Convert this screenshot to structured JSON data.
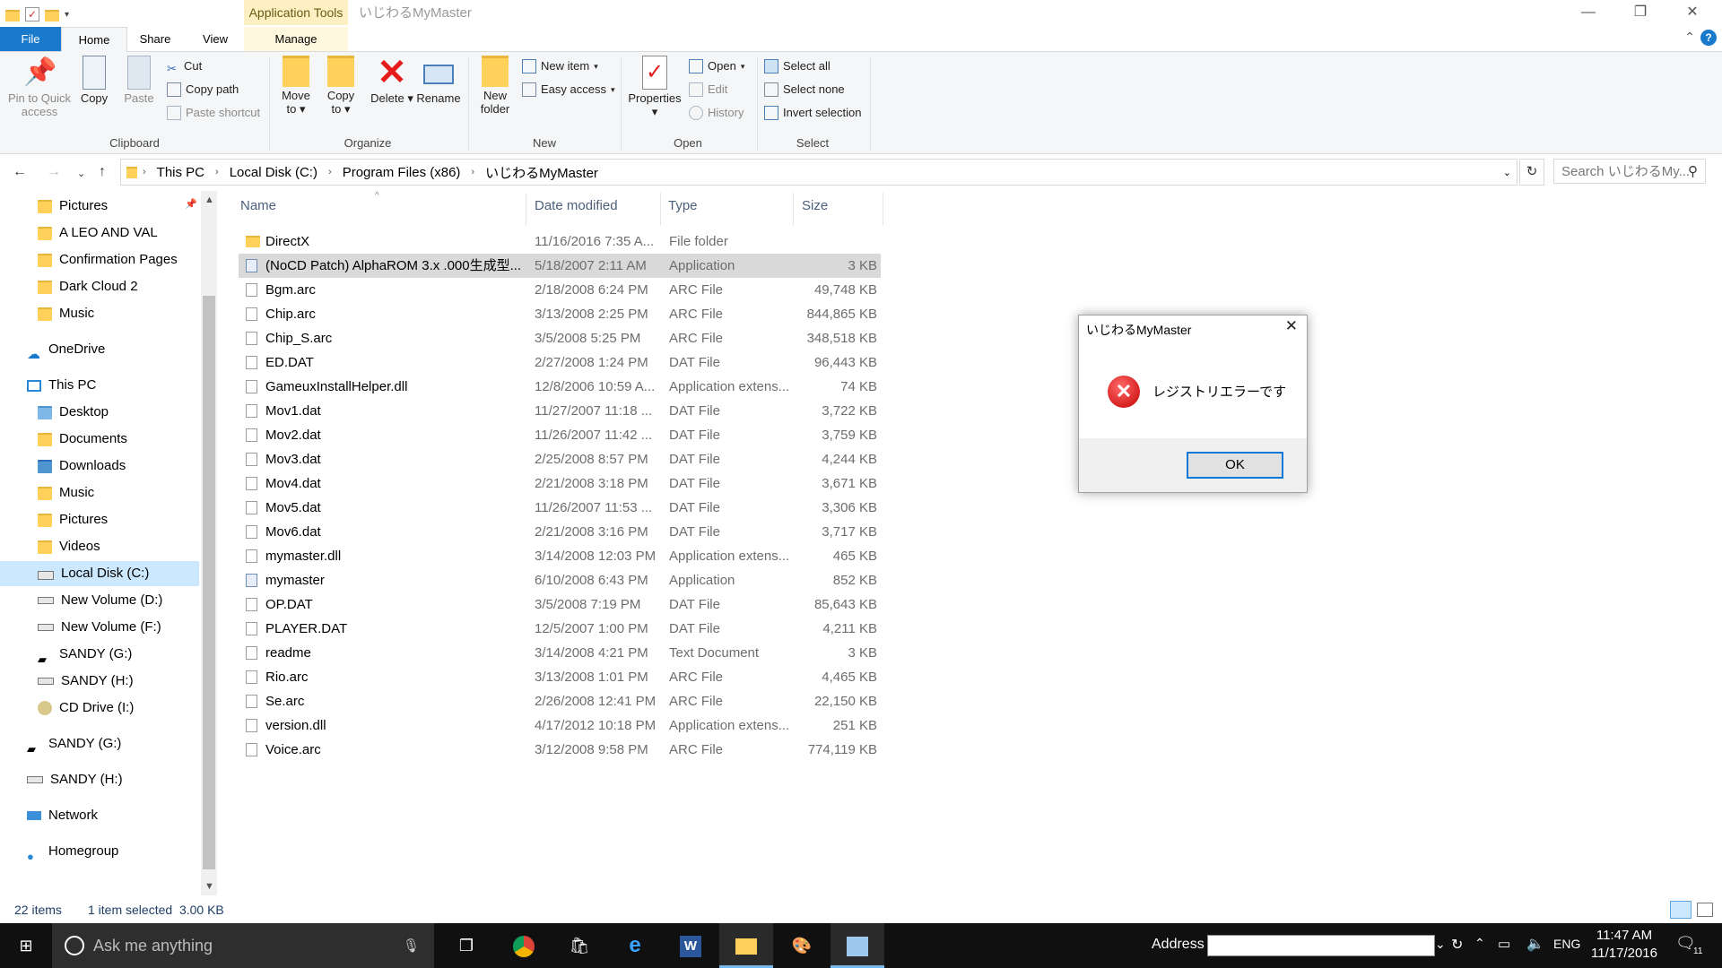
{
  "window": {
    "title": "いじわるMyMaster",
    "context_tab": "Application Tools",
    "controls": {
      "minimize": "—",
      "maximize": "❐",
      "close": "✕"
    }
  },
  "ribbon_tabs": {
    "file": "File",
    "home": "Home",
    "share": "Share",
    "view": "View",
    "manage": "Manage"
  },
  "ribbon": {
    "clipboard": {
      "label": "Clipboard",
      "pin": "Pin to Quick access",
      "copy": "Copy",
      "paste": "Paste",
      "cut": "Cut",
      "copy_path": "Copy path",
      "paste_shortcut": "Paste shortcut"
    },
    "organize": {
      "label": "Organize",
      "move_to": "Move to",
      "copy_to": "Copy to",
      "delete": "Delete",
      "rename": "Rename"
    },
    "new": {
      "label": "New",
      "new_folder": "New folder",
      "new_item": "New item",
      "easy_access": "Easy access"
    },
    "open": {
      "label": "Open",
      "properties": "Properties",
      "open": "Open",
      "edit": "Edit",
      "history": "History"
    },
    "select": {
      "label": "Select",
      "select_all": "Select all",
      "select_none": "Select none",
      "invert": "Invert selection"
    }
  },
  "address": {
    "crumbs": [
      "This PC",
      "Local Disk (C:)",
      "Program Files (x86)",
      "いじわるMyMaster"
    ],
    "search_placeholder": "Search いじわるMy..."
  },
  "nav": [
    {
      "label": "Pictures",
      "icon": "folder-icon"
    },
    {
      "label": "A LEO AND VAL",
      "icon": "folder-icon"
    },
    {
      "label": "Confirmation Pages",
      "icon": "folder-icon"
    },
    {
      "label": "Dark Cloud 2",
      "icon": "folder-icon"
    },
    {
      "label": "Music",
      "icon": "folder-icon"
    },
    {
      "label": "OneDrive",
      "icon": "cloud-icon"
    },
    {
      "label": "This PC",
      "icon": "computer-icon"
    },
    {
      "label": "Desktop",
      "icon": "folder-icon"
    },
    {
      "label": "Documents",
      "icon": "folder-icon"
    },
    {
      "label": "Downloads",
      "icon": "folder-icon"
    },
    {
      "label": "Music",
      "icon": "folder-icon"
    },
    {
      "label": "Pictures",
      "icon": "folder-icon"
    },
    {
      "label": "Videos",
      "icon": "folder-icon"
    },
    {
      "label": "Local Disk (C:)",
      "icon": "drive-icon"
    },
    {
      "label": "New Volume (D:)",
      "icon": "drive-icon"
    },
    {
      "label": "New Volume (F:)",
      "icon": "drive-icon"
    },
    {
      "label": "SANDY (G:)",
      "icon": "usb-drive-icon"
    },
    {
      "label": "SANDY (H:)",
      "icon": "drive-icon"
    },
    {
      "label": "CD Drive (I:)",
      "icon": "cd-drive-icon"
    },
    {
      "label": "SANDY (G:)",
      "icon": "usb-drive-icon"
    },
    {
      "label": "SANDY (H:)",
      "icon": "drive-icon"
    },
    {
      "label": "Network",
      "icon": "network-icon"
    },
    {
      "label": "Homegroup",
      "icon": "homegroup-icon"
    }
  ],
  "columns": {
    "name": "Name",
    "date": "Date modified",
    "type": "Type",
    "size": "Size"
  },
  "files": [
    {
      "name": "DirectX",
      "date": "11/16/2016 7:35 A...",
      "type": "File folder",
      "size": "",
      "kind": "folder"
    },
    {
      "name": "(NoCD Patch) AlphaROM 3.x .000生成型...",
      "date": "5/18/2007 2:11 AM",
      "type": "Application",
      "size": "3 KB",
      "kind": "app"
    },
    {
      "name": "Bgm.arc",
      "date": "2/18/2008 6:24 PM",
      "type": "ARC File",
      "size": "49,748 KB",
      "kind": "file"
    },
    {
      "name": "Chip.arc",
      "date": "3/13/2008 2:25 PM",
      "type": "ARC File",
      "size": "844,865 KB",
      "kind": "file"
    },
    {
      "name": "Chip_S.arc",
      "date": "3/5/2008 5:25 PM",
      "type": "ARC File",
      "size": "348,518 KB",
      "kind": "file"
    },
    {
      "name": "ED.DAT",
      "date": "2/27/2008 1:24 PM",
      "type": "DAT File",
      "size": "96,443 KB",
      "kind": "file"
    },
    {
      "name": "GameuxInstallHelper.dll",
      "date": "12/8/2006 10:59 A...",
      "type": "Application extens...",
      "size": "74 KB",
      "kind": "dll"
    },
    {
      "name": "Mov1.dat",
      "date": "11/27/2007 11:18 ...",
      "type": "DAT File",
      "size": "3,722 KB",
      "kind": "file"
    },
    {
      "name": "Mov2.dat",
      "date": "11/26/2007 11:42 ...",
      "type": "DAT File",
      "size": "3,759 KB",
      "kind": "file"
    },
    {
      "name": "Mov3.dat",
      "date": "2/25/2008 8:57 PM",
      "type": "DAT File",
      "size": "4,244 KB",
      "kind": "file"
    },
    {
      "name": "Mov4.dat",
      "date": "2/21/2008 3:18 PM",
      "type": "DAT File",
      "size": "3,671 KB",
      "kind": "file"
    },
    {
      "name": "Mov5.dat",
      "date": "11/26/2007 11:53 ...",
      "type": "DAT File",
      "size": "3,306 KB",
      "kind": "file"
    },
    {
      "name": "Mov6.dat",
      "date": "2/21/2008 3:16 PM",
      "type": "DAT File",
      "size": "3,717 KB",
      "kind": "file"
    },
    {
      "name": "mymaster.dll",
      "date": "3/14/2008 12:03 PM",
      "type": "Application extens...",
      "size": "465 KB",
      "kind": "dll"
    },
    {
      "name": "mymaster",
      "date": "6/10/2008 6:43 PM",
      "type": "Application",
      "size": "852 KB",
      "kind": "app"
    },
    {
      "name": "OP.DAT",
      "date": "3/5/2008 7:19 PM",
      "type": "DAT File",
      "size": "85,643 KB",
      "kind": "file"
    },
    {
      "name": "PLAYER.DAT",
      "date": "12/5/2007 1:00 PM",
      "type": "DAT File",
      "size": "4,211 KB",
      "kind": "file"
    },
    {
      "name": "readme",
      "date": "3/14/2008 4:21 PM",
      "type": "Text Document",
      "size": "3 KB",
      "kind": "file"
    },
    {
      "name": "Rio.arc",
      "date": "3/13/2008 1:01 PM",
      "type": "ARC File",
      "size": "4,465 KB",
      "kind": "file"
    },
    {
      "name": "Se.arc",
      "date": "2/26/2008 12:41 PM",
      "type": "ARC File",
      "size": "22,150 KB",
      "kind": "file"
    },
    {
      "name": "version.dll",
      "date": "4/17/2012 10:18 PM",
      "type": "Application extens...",
      "size": "251 KB",
      "kind": "dll"
    },
    {
      "name": "Voice.arc",
      "date": "3/12/2008 9:58 PM",
      "type": "ARC File",
      "size": "774,119 KB",
      "kind": "file"
    }
  ],
  "status": {
    "count": "22 items",
    "selection": "1 item selected  3.00 KB"
  },
  "dialog": {
    "title": "いじわるMyMaster",
    "message": "レジストリエラーです",
    "ok": "OK"
  },
  "taskbar": {
    "search": "Ask me anything",
    "address_label": "Address",
    "lang": "ENG",
    "time": "11:47 AM",
    "date": "11/17/2016",
    "notifications": "11"
  },
  "colors": {
    "accent": "#1979ca",
    "selection": "#cce8ff",
    "error": "#c40000"
  }
}
